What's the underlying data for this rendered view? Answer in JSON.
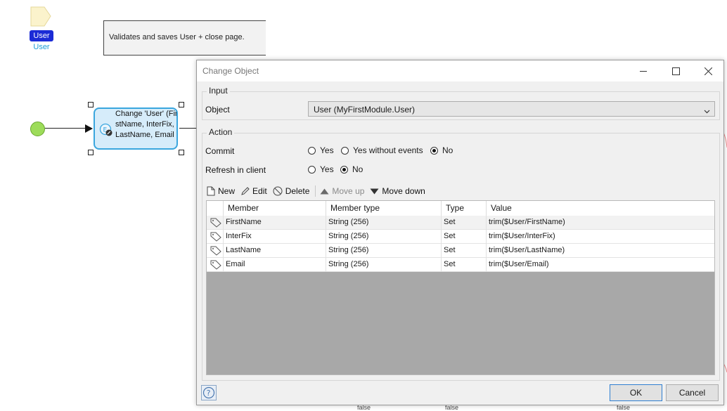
{
  "canvas": {
    "parameter": {
      "badge": "User",
      "name": "User"
    },
    "annotation": {
      "text": "Validates and saves User + close page."
    },
    "activity": {
      "label": "Change 'User' (FirstName, InterFix, LastName, Email"
    },
    "bottom_labels": [
      "false",
      "false",
      "false"
    ]
  },
  "dialog": {
    "title": "Change Object",
    "input_group": {
      "title": "Input",
      "object_label": "Object",
      "object_value": "User (MyFirstModule.User)"
    },
    "action_group": {
      "title": "Action",
      "commit": {
        "label": "Commit",
        "options": [
          {
            "label": "Yes",
            "selected": false
          },
          {
            "label": "Yes without events",
            "selected": false
          },
          {
            "label": "No",
            "selected": true
          }
        ]
      },
      "refresh": {
        "label": "Refresh in client",
        "options": [
          {
            "label": "Yes",
            "selected": false
          },
          {
            "label": "No",
            "selected": true
          }
        ]
      },
      "toolbar": {
        "new": "New",
        "edit": "Edit",
        "delete": "Delete",
        "move_up": "Move up",
        "move_down": "Move down"
      },
      "table": {
        "columns": [
          "Member",
          "Member type",
          "Type",
          "Value"
        ],
        "rows": [
          {
            "member": "FirstName",
            "member_type": "String (256)",
            "type": "Set",
            "value": "trim($User/FirstName)"
          },
          {
            "member": "InterFix",
            "member_type": "String (256)",
            "type": "Set",
            "value": "trim($User/InterFix)"
          },
          {
            "member": "LastName",
            "member_type": "String (256)",
            "type": "Set",
            "value": "trim($User/LastName)"
          },
          {
            "member": "Email",
            "member_type": "String (256)",
            "type": "Set",
            "value": "trim($User/Email)"
          }
        ]
      }
    },
    "buttons": {
      "ok": "OK",
      "cancel": "Cancel"
    },
    "help_glyph": "?"
  }
}
